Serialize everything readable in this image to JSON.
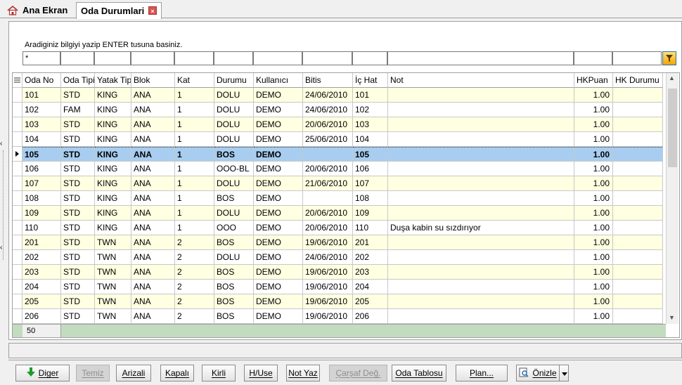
{
  "tabs": {
    "home_label": "Ana Ekran",
    "active_label": "Oda Durumlari",
    "close_glyph": "×"
  },
  "search": {
    "instruction": "Aradiginiz bilgiyi yazip ENTER tusuna basiniz.",
    "first_value": "*"
  },
  "grid": {
    "columns": [
      "Oda No",
      "Oda Tipi",
      "Yatak Tipi",
      "Blok",
      "Kat",
      "Durumu",
      "Kullanıcı",
      "Bitis",
      "İç Hat",
      "Not",
      "HKPuan",
      "HK Durumu"
    ],
    "rows": [
      [
        "101",
        "STD",
        "KING",
        "ANA",
        "1",
        "DOLU",
        "DEMO",
        "24/06/2010",
        "101",
        "",
        "1.00",
        ""
      ],
      [
        "102",
        "FAM",
        "KING",
        "ANA",
        "1",
        "DOLU",
        "DEMO",
        "24/06/2010",
        "102",
        "",
        "1.00",
        ""
      ],
      [
        "103",
        "STD",
        "KING",
        "ANA",
        "1",
        "DOLU",
        "DEMO",
        "20/06/2010",
        "103",
        "",
        "1.00",
        ""
      ],
      [
        "104",
        "STD",
        "KING",
        "ANA",
        "1",
        "DOLU",
        "DEMO",
        "25/06/2010",
        "104",
        "",
        "1.00",
        ""
      ],
      [
        "105",
        "STD",
        "KING",
        "ANA",
        "1",
        "BOS",
        "DEMO",
        "",
        "105",
        "",
        "1.00",
        ""
      ],
      [
        "106",
        "STD",
        "KING",
        "ANA",
        "1",
        "OOO-BL",
        "DEMO",
        "20/06/2010",
        "106",
        "",
        "1.00",
        ""
      ],
      [
        "107",
        "STD",
        "KING",
        "ANA",
        "1",
        "DOLU",
        "DEMO",
        "21/06/2010",
        "107",
        "",
        "1.00",
        ""
      ],
      [
        "108",
        "STD",
        "KING",
        "ANA",
        "1",
        "BOS",
        "DEMO",
        "",
        "108",
        "",
        "1.00",
        ""
      ],
      [
        "109",
        "STD",
        "KING",
        "ANA",
        "1",
        "DOLU",
        "DEMO",
        "20/06/2010",
        "109",
        "",
        "1.00",
        ""
      ],
      [
        "110",
        "STD",
        "KING",
        "ANA",
        "1",
        "OOO",
        "DEMO",
        "20/06/2010",
        "110",
        "Duşa kabin su sızdırıyor",
        "1.00",
        ""
      ],
      [
        "201",
        "STD",
        "TWN",
        "ANA",
        "2",
        "BOS",
        "DEMO",
        "19/06/2010",
        "201",
        "",
        "1.00",
        ""
      ],
      [
        "202",
        "STD",
        "TWN",
        "ANA",
        "2",
        "DOLU",
        "DEMO",
        "24/06/2010",
        "202",
        "",
        "1.00",
        ""
      ],
      [
        "203",
        "STD",
        "TWN",
        "ANA",
        "2",
        "BOS",
        "DEMO",
        "19/06/2010",
        "203",
        "",
        "1.00",
        ""
      ],
      [
        "204",
        "STD",
        "TWN",
        "ANA",
        "2",
        "BOS",
        "DEMO",
        "19/06/2010",
        "204",
        "",
        "1.00",
        ""
      ],
      [
        "205",
        "STD",
        "TWN",
        "ANA",
        "2",
        "BOS",
        "DEMO",
        "19/06/2010",
        "205",
        "",
        "1.00",
        ""
      ],
      [
        "206",
        "STD",
        "TWN",
        "ANA",
        "2",
        "BOS",
        "DEMO",
        "19/06/2010",
        "206",
        "",
        "1.00",
        ""
      ]
    ],
    "selected_row": 4,
    "record_count": "50"
  },
  "buttons": {
    "diger": "Diger",
    "temiz": "Temiz",
    "arizali": "Arizali",
    "kapali": "Kapalı",
    "kirli": "Kirli",
    "huse": "H/Use",
    "notyaz": "Not Yaz",
    "carsaf": "Çarşaf Değ.",
    "odatablosu": "Oda Tablosu",
    "plan": "Plan...",
    "onizle": "Önizle"
  },
  "colors": {
    "row_yellow": "#ffffe1",
    "row_selected": "#a8cdf0",
    "footer_green": "#c2dcc0"
  }
}
